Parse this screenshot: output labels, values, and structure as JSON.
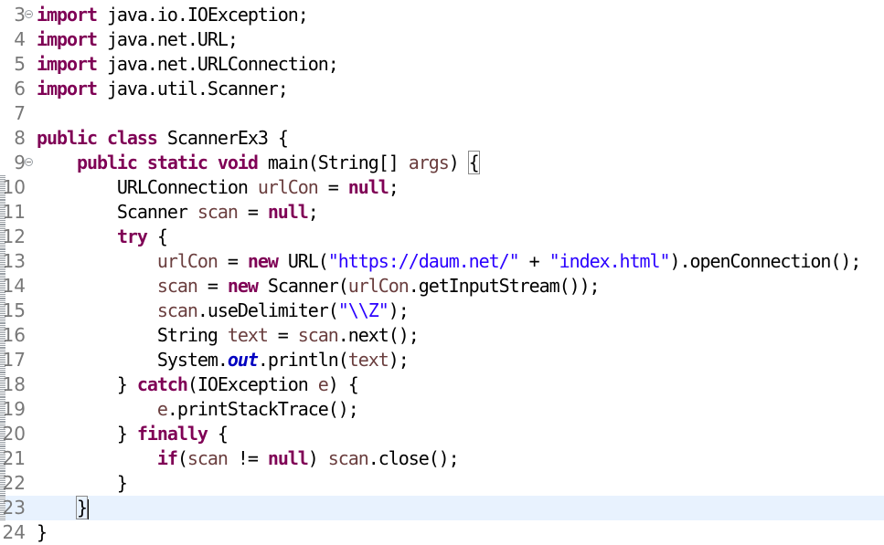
{
  "editor": {
    "language": "Java",
    "current_line": "23",
    "lines": [
      {
        "num": "3",
        "text": "import java.io.IOException;",
        "fold": true
      },
      {
        "num": "4",
        "text": "import java.net.URL;"
      },
      {
        "num": "5",
        "text": "import java.net.URLConnection;"
      },
      {
        "num": "6",
        "text": "import java.util.Scanner;"
      },
      {
        "num": "7",
        "text": ""
      },
      {
        "num": "8",
        "text": "public class ScannerEx3 {"
      },
      {
        "num": "9",
        "text": "    public static void main(String[] args) {",
        "fold": true
      },
      {
        "num": "10",
        "text": "        URLConnection urlCon = null;"
      },
      {
        "num": "11",
        "text": "        Scanner scan = null;"
      },
      {
        "num": "12",
        "text": "        try {"
      },
      {
        "num": "13",
        "text": "            urlCon = new URL(\"https://daum.net/\" + \"index.html\").openConnection();"
      },
      {
        "num": "14",
        "text": "            scan = new Scanner(urlCon.getInputStream());"
      },
      {
        "num": "15",
        "text": "            scan.useDelimiter(\"\\\\Z\");"
      },
      {
        "num": "16",
        "text": "            String text = scan.next();"
      },
      {
        "num": "17",
        "text": "            System.out.println(text);"
      },
      {
        "num": "18",
        "text": "        } catch(IOException e) {"
      },
      {
        "num": "19",
        "text": "            e.printStackTrace();"
      },
      {
        "num": "20",
        "text": "        } finally {"
      },
      {
        "num": "21",
        "text": "            if(scan != null) scan.close();"
      },
      {
        "num": "22",
        "text": "        }"
      },
      {
        "num": "23",
        "text": "    }"
      },
      {
        "num": "24",
        "text": "}"
      }
    ],
    "colors": {
      "keyword": "#7f0055",
      "string": "#2a00ff",
      "static_field": "#0000c0",
      "local_variable": "#6a3e3e",
      "line_number": "#787878",
      "current_line_bg": "#e8f2fe"
    }
  }
}
